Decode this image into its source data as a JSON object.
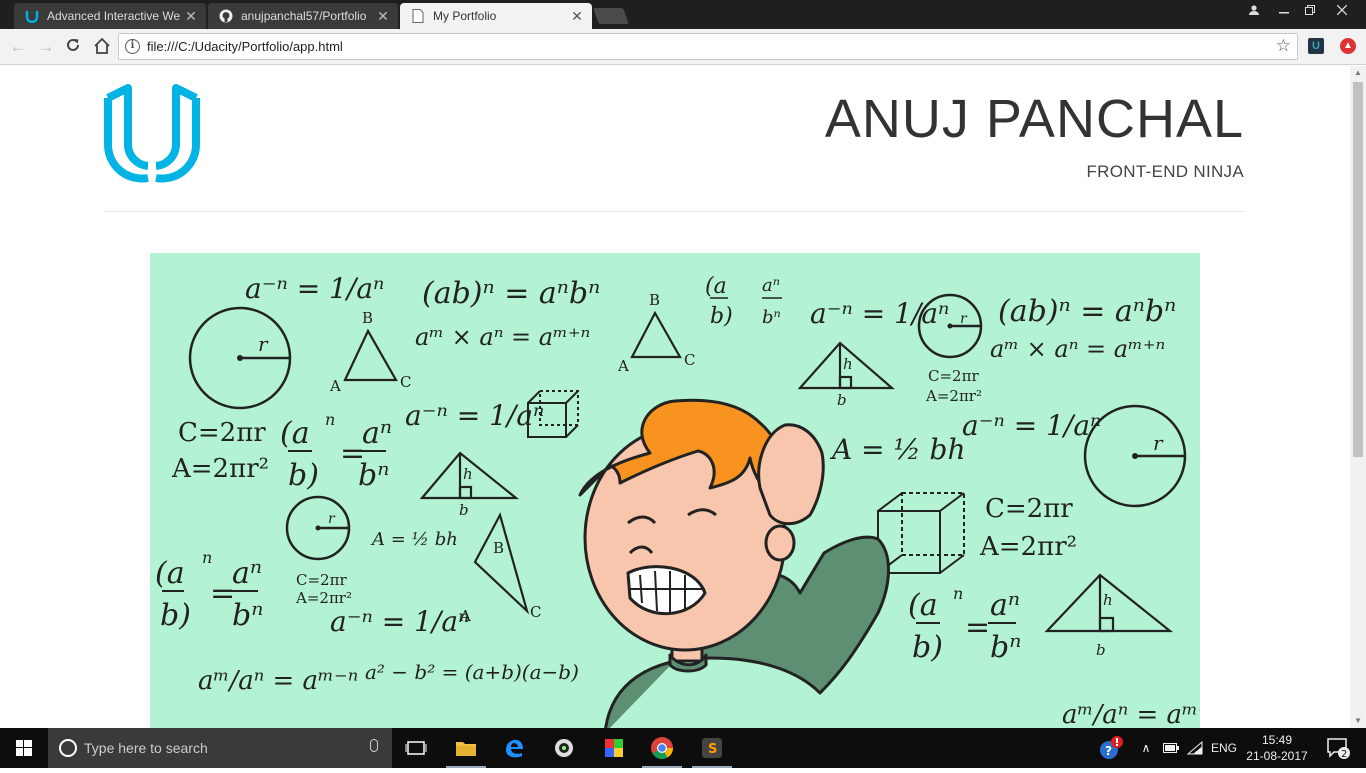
{
  "browser": {
    "tabs": [
      {
        "title": "Advanced Interactive We",
        "icon": "udacity-icon",
        "active": false
      },
      {
        "title": "anujpanchal57/Portfolio",
        "icon": "github-icon",
        "active": false
      },
      {
        "title": "My Portfolio",
        "icon": "page-icon",
        "active": true
      }
    ],
    "url": "file:///C:/Udacity/Portfolio/app.html"
  },
  "page": {
    "name": "ANUJ PANCHAL",
    "subtitle": "FRONT-END NINJA",
    "accent_color": "#02b3e4",
    "hero_background": "#b3f3d3"
  },
  "hero_formulas": {
    "f1": "a⁻ⁿ = 1/aⁿ",
    "f2": "(ab)ⁿ = aⁿbⁿ",
    "f3": "aᵐ × aⁿ = aᵐ⁺ⁿ",
    "f4": "C=2πr",
    "f5": "A=2πr²",
    "f6": "A = ½ bh",
    "f7": "aᵐ/aⁿ = aᵐ⁻ⁿ",
    "f8": "a² − b² = (a+b)(a−b)",
    "r": "r",
    "h": "h",
    "b": "b",
    "A": "A",
    "B": "B",
    "C": "C"
  },
  "taskbar": {
    "search_placeholder": "Type here to search",
    "language": "ENG",
    "time": "15:49",
    "date": "21-08-2017",
    "notifications": "2"
  }
}
